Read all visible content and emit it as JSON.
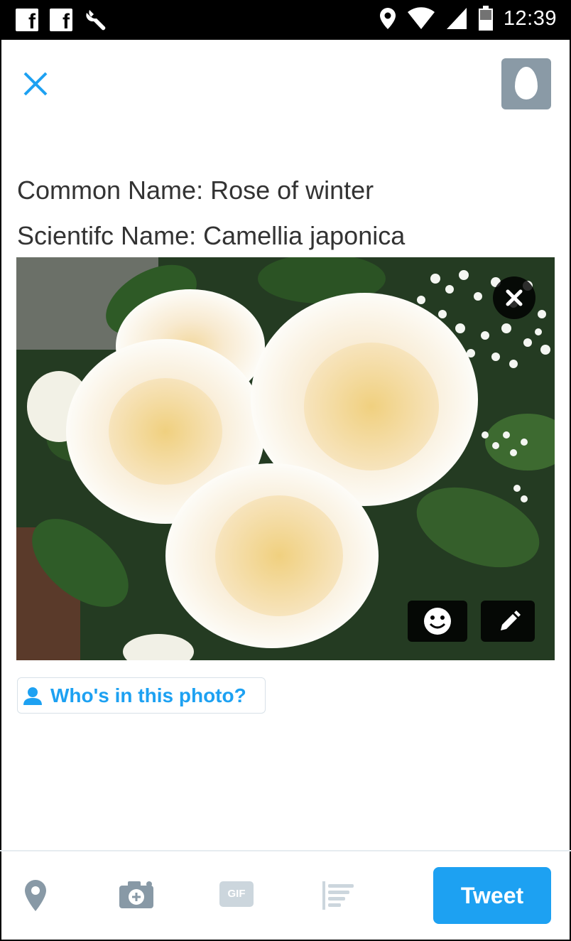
{
  "status_bar": {
    "time": "12:39",
    "left_icons": [
      "facebook-icon",
      "facebook-icon",
      "wrench-icon"
    ],
    "right_icons": [
      "location-icon",
      "wifi-icon",
      "cell-signal-icon",
      "battery-icon"
    ],
    "fb_glyph": "f"
  },
  "compose": {
    "close_icon": "close-icon",
    "avatar_icon": "default-egg-avatar-icon",
    "text_lines": [
      "Common Name: Rose of winter",
      "Scientifc Name: Camellia japonica"
    ]
  },
  "media": {
    "description_icon": "flower-photo",
    "overlay_buttons": [
      "remove-photo-icon",
      "sticker-icon",
      "edit-pencil-icon"
    ]
  },
  "tag_people": {
    "label": "Who's in this photo?",
    "icon": "person-icon"
  },
  "toolbar": {
    "icons": [
      "location-pin-icon",
      "camera-icon",
      "gif-icon",
      "poll-icon"
    ],
    "gif_text": "GIF",
    "tweet_label": "Tweet"
  },
  "colors": {
    "accent": "#1da1f2",
    "avatar_bg": "#8a9aa6",
    "toolbar_icon": "#8899a6",
    "disabled_icon": "#ccd6dd"
  }
}
